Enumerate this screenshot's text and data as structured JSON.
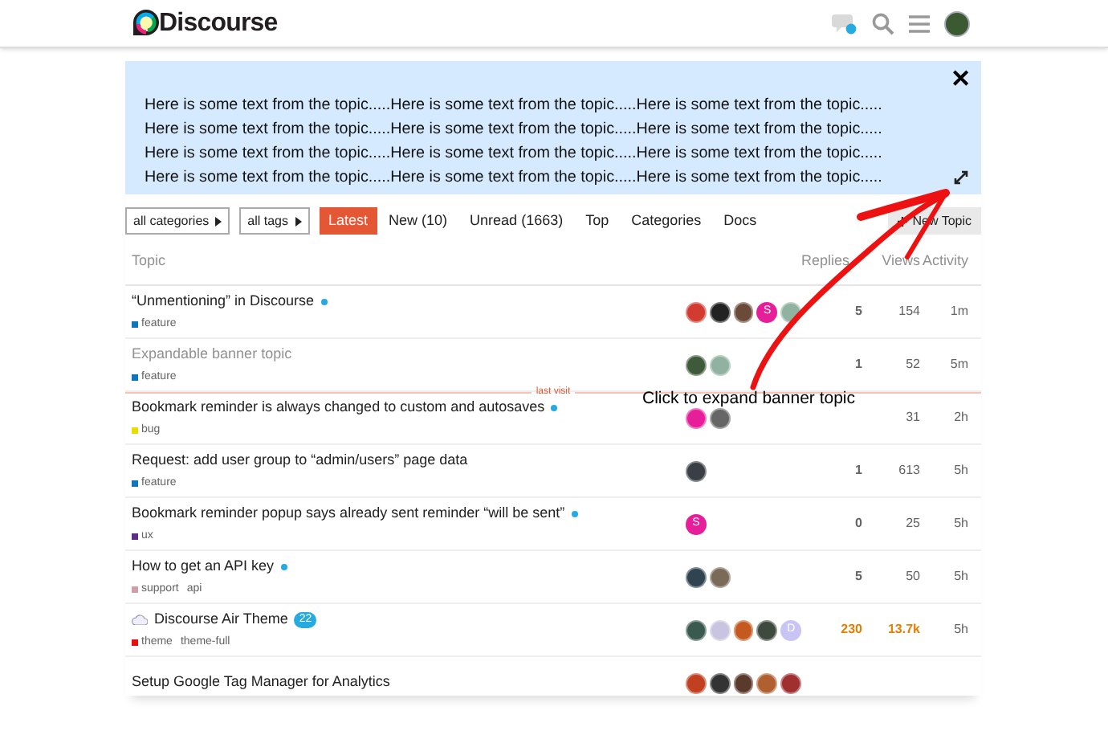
{
  "header": {
    "logo": "Discourse",
    "chat_unread": true
  },
  "banner_close": "✕",
  "banner": {
    "lines": [
      "Here is some text from the topic.....Here is some text from the topic.....Here is some text from the topic.....",
      "Here is some text from the topic.....Here is some text from the topic.....Here is some text from the topic.....",
      "Here is some text from the topic.....Here is some text from the topic.....Here is some text from the topic.....",
      "Here is some text from the topic.....Here is some text from the topic.....Here is some text from the topic....."
    ]
  },
  "filters": [
    {
      "label": "all categories"
    },
    {
      "label": "all tags"
    }
  ],
  "tabs": [
    {
      "label": "Latest",
      "selected": true
    },
    {
      "label": "New (10)",
      "selected": false
    },
    {
      "label": "Unread (1663)",
      "selected": false
    },
    {
      "label": "Top",
      "selected": false
    },
    {
      "label": "Categories",
      "selected": false
    },
    {
      "label": "Docs",
      "selected": false
    }
  ],
  "new_topic_button": "New Topic",
  "columns": [
    "Topic",
    "Replies",
    "Views",
    "Activity"
  ],
  "topics": [
    {
      "title": "“Unmentioning” in Discourse",
      "unread": true,
      "visited": false,
      "hot": false,
      "category": {
        "name": "feature",
        "color": "#0e76bd"
      },
      "posters": [
        {
          "kind": "photo",
          "color": "#d23b2f"
        },
        {
          "kind": "photo",
          "color": "#222222"
        },
        {
          "kind": "photo",
          "color": "#6b4a3a"
        },
        {
          "kind": "letter",
          "letter": "S",
          "color": "#e61e99"
        },
        {
          "kind": "photo",
          "color": "#8fb3a0"
        }
      ],
      "replies": "5",
      "views": "154",
      "activity": "1m"
    },
    {
      "title": "Expandable banner topic",
      "unread": false,
      "visited": true,
      "hot": false,
      "category": {
        "name": "feature",
        "color": "#0e76bd"
      },
      "posters": [
        {
          "kind": "photo",
          "color": "#3f5a3a"
        },
        {
          "kind": "photo",
          "color": "#8fb3a0"
        }
      ],
      "replies": "1",
      "views": "52",
      "activity": "5m",
      "last_visit_after": "last visit"
    },
    {
      "title": "Bookmark reminder is always changed to custom and autosaves",
      "unread": true,
      "visited": false,
      "hot": false,
      "category": {
        "name": "bug",
        "color": "#e9dd00"
      },
      "posters": [
        {
          "kind": "photo",
          "color": "#e61e99"
        },
        {
          "kind": "photo",
          "color": "#666666"
        }
      ],
      "views": "31",
      "activity": "2h"
    },
    {
      "title": "Request: add user group to “admin/users” page data",
      "unread": false,
      "visited": false,
      "hot": false,
      "category": {
        "name": "feature",
        "color": "#0e76bd"
      },
      "posters": [
        {
          "kind": "photo",
          "color": "#3a3f45"
        }
      ],
      "replies": "1",
      "views": "613",
      "activity": "5h"
    },
    {
      "title": "Bookmark reminder popup says already sent reminder “will be sent”",
      "unread": true,
      "visited": false,
      "hot": false,
      "category": {
        "name": "ux",
        "color": "#5f2d88"
      },
      "posters": [
        {
          "kind": "letter",
          "letter": "S",
          "color": "#e61e99"
        }
      ],
      "replies": "0",
      "views": "25",
      "activity": "5h"
    },
    {
      "title": "How to get an API key",
      "unread": true,
      "visited": false,
      "hot": false,
      "category": {
        "name": "support",
        "color": "#ce9fa6"
      },
      "tags": [
        "api"
      ],
      "posters": [
        {
          "kind": "photo",
          "color": "#2f4450"
        },
        {
          "kind": "photo",
          "color": "#7a6a58"
        }
      ],
      "replies": "5",
      "views": "50",
      "activity": "5h"
    },
    {
      "title": "Discourse Air Theme",
      "emoji": true,
      "badge": "22",
      "unread": false,
      "visited": false,
      "hot": true,
      "category": {
        "name": "theme",
        "color": "#e90f0f"
      },
      "tags": [
        "theme-full"
      ],
      "posters": [
        {
          "kind": "photo",
          "color": "#3a5a50"
        },
        {
          "kind": "photo",
          "color": "#c9c5e0"
        },
        {
          "kind": "photo",
          "color": "#c55a20"
        },
        {
          "kind": "photo",
          "color": "#3d4a3d"
        },
        {
          "kind": "letter",
          "letter": "D",
          "color": "#c8c4f4"
        }
      ],
      "replies": "230",
      "views": "13.7k",
      "activity": "5h"
    },
    {
      "title": "Setup Google Tag Manager for Analytics",
      "unread": false,
      "visited": false,
      "hot": false,
      "posters": [
        {
          "kind": "photo",
          "color": "#c04020"
        },
        {
          "kind": "photo",
          "color": "#333333"
        },
        {
          "kind": "photo",
          "color": "#5a3a2a"
        },
        {
          "kind": "photo",
          "color": "#b06030"
        },
        {
          "kind": "photo",
          "color": "#a03030"
        }
      ]
    }
  ],
  "annotation": {
    "text": "Click to expand banner topic"
  }
}
